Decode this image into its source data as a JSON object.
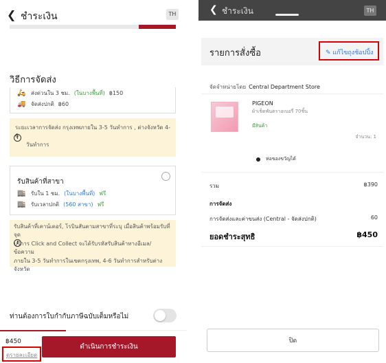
{
  "left": {
    "header_title": "ชำระเงิน",
    "back_glyph": "❮",
    "lang": "TH",
    "section_title": "วิธีการจัดส่ง",
    "delivery_options": [
      {
        "icon": "delivery-fast-icon",
        "label": "ส่งด่วนใน 3 ชม.",
        "note": "(ในบางพื้นที่)",
        "price": "฿150"
      },
      {
        "icon": "truck-icon",
        "label": "จัดส่งปกติ",
        "price": "฿60"
      }
    ],
    "notice1_line1": "ระยะเวลาการจัดส่ง กรุงเทพภายใน 3-5 วันทำการ , ต่างจังหวัด 4-6",
    "notice1_line2": "วันทำการ",
    "pickup_title": "รับสินค้าที่สาขา",
    "pickup_options": [
      {
        "icon": "store-icon",
        "label": "รับใน 1 ชม.",
        "note": "(ในบางพื้นที่)",
        "price": "ฟรี"
      },
      {
        "icon": "store-icon",
        "label": "รับเวลาปกติ",
        "note": "(560 สาขา)",
        "price": "ฟรี"
      }
    ],
    "notice2_lines": [
      "รับสินค้าที่เคาน์เตอร์, โรบินสันตามสาขาที่ระบุ เมื่อสินค้าพร้อมรับที่จุด",
      "บริการ Click and Collect จะได้รับรหัสรับสินค้าทางอีเมล/ ข้อความ",
      "ภายใน 3-5 วันทำการในเขตกรุงเทพ, 4-6 วันทำการสำหรับต่าง",
      "จังหวัด"
    ],
    "toggle_label": "ท่านต้องการใบกำกับภาษีฉบับเต็มหรือไม่",
    "total": "฿450",
    "details_link": "ดูรายละเอียด",
    "pay_button": "ดำเนินการชำระเงิน"
  },
  "right": {
    "header_title": "ชำระเงิน",
    "back_glyph": "❮",
    "lang": "TH",
    "sheet_title": "รายการสั่งซื้อ",
    "edit_label": "แก้ไขถุงช้อปปิ้ง",
    "seller_label": "จัดจำหน่ายโดย",
    "seller_name": "Central Department Store",
    "product": {
      "brand": "PIGEON",
      "name": "ผ้าเช็ดพันตราอเบอรี่ 70ชิ้น",
      "tag": "มีสินค้า",
      "qty": "จำนวน: 1"
    },
    "gift_label": "ห่อของขวัญได้",
    "subtotal_label": "รวม",
    "subtotal_value": "฿390",
    "shipping_heading": "การจัดส่ง",
    "shipping_label": "การจัดส่งและค่าขนส่ง (Central - จัดส่งปกติ)",
    "shipping_value": "60",
    "grand_label": "ยอดชำระสุทธิ",
    "grand_value": "฿450",
    "close_button": "ปิด"
  },
  "colors": {
    "brand_red": "#a5182a",
    "highlight_red": "#d60000",
    "link_blue": "#2d7be0",
    "notice_bg": "#fcf3d9"
  }
}
